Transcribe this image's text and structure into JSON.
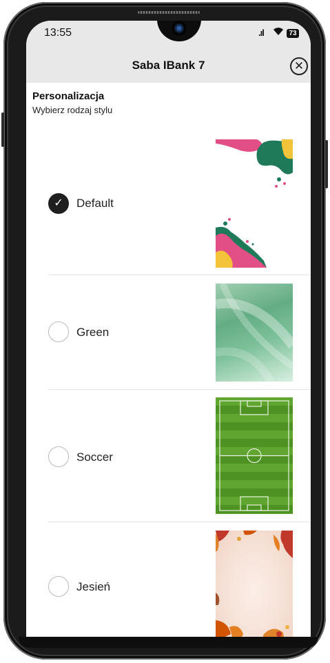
{
  "status_bar": {
    "time": "13:55",
    "signal": ".ıl",
    "wifi": "▾",
    "battery": "73"
  },
  "header": {
    "title": "Saba IBank 7",
    "close_icon": "✕"
  },
  "section": {
    "title": "Personalizacja",
    "subtitle": "Wybierz rodzaj stylu"
  },
  "styles": [
    {
      "label": "Default",
      "selected": true,
      "check": "✓"
    },
    {
      "label": "Green",
      "selected": false
    },
    {
      "label": "Soccer",
      "selected": false
    },
    {
      "label": "Jesień",
      "selected": false
    }
  ],
  "colors": {
    "header_bg": "#e8e8e8",
    "radio_selected": "#1f1f1f",
    "accent_pink": "#e24e86",
    "accent_teal": "#1f7a5a",
    "accent_yellow": "#f3c43a"
  }
}
